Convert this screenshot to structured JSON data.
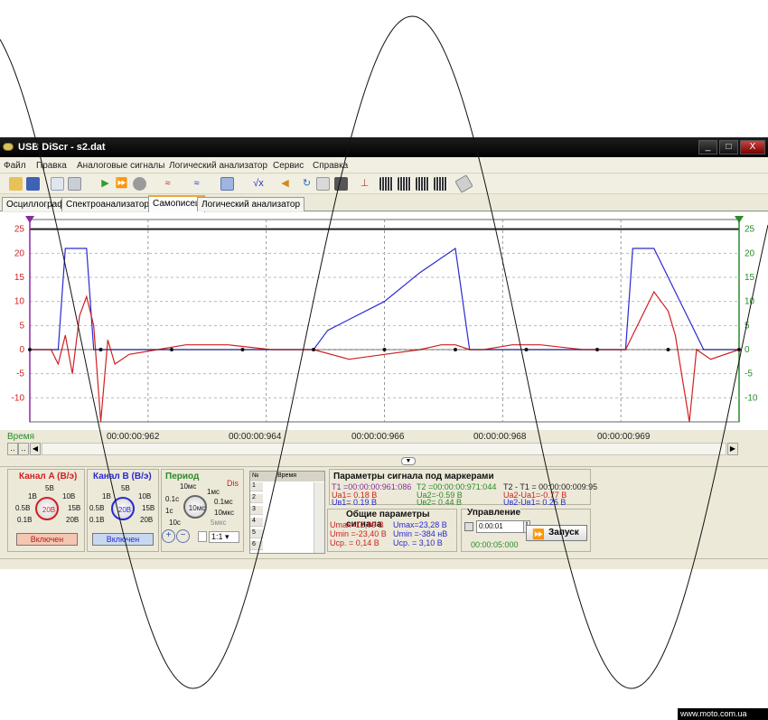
{
  "window": {
    "title": "USB DiScr - s2.dat",
    "min_label": "_",
    "max_label": "□",
    "close_label": "X"
  },
  "menu": [
    "Файл",
    "Правка",
    "Аналоговые сигналы",
    "Логический анализатор",
    "Сервис",
    "Справка"
  ],
  "toolbar": {
    "icons": [
      "open-folder-icon",
      "save-icon",
      "print-preview-icon",
      "print-icon",
      "play-icon",
      "play-step-icon",
      "stop-icon",
      "signal-a-icon",
      "signal-b-icon",
      "table-icon",
      "sqrt-icon",
      "speaker-icon",
      "refresh-icon",
      "copy-icon",
      "save-disk-icon",
      "export-icon",
      "channel-1-icon",
      "channel-2-icon",
      "channel-3-icon",
      "channel-4-icon",
      "eraser-icon"
    ]
  },
  "tabs": [
    {
      "label": "Осциллограф",
      "active": false
    },
    {
      "label": "Спектроанализатор",
      "active": false
    },
    {
      "label": "Самописец",
      "active": true
    },
    {
      "label": "Логический анализатор",
      "active": false
    }
  ],
  "chart_data": {
    "type": "line",
    "xlabel": "Время",
    "x_tick_labels": [
      "00:00:00:962",
      "00:00:00:964",
      "00:00:00:966",
      "00:00:00:968",
      "00:00:00:969"
    ],
    "left_axis_ticks": [
      "25",
      "20",
      "15",
      "10",
      "5",
      "0",
      "-5",
      "-10"
    ],
    "right_axis_ticks": [
      "25",
      "20",
      "15",
      "10",
      "5",
      "0",
      "-5",
      "-10"
    ],
    "ylim": [
      -15,
      27
    ],
    "grid": true,
    "series": [
      {
        "color": "#2a2ad0",
        "x": [
          0,
          4,
          5,
          7,
          8,
          9,
          12,
          20,
          30,
          40,
          41,
          42,
          50,
          55,
          60,
          62,
          70,
          75,
          80,
          84,
          85,
          88,
          95,
          100
        ],
        "values": [
          0,
          0,
          21,
          21,
          21,
          0,
          0,
          0,
          0,
          0,
          2,
          4,
          10,
          16,
          21,
          0,
          0,
          0,
          0,
          0,
          21,
          21,
          0,
          0
        ]
      },
      {
        "color": "#d02020",
        "x": [
          0,
          3,
          4,
          5,
          6,
          7,
          8,
          9,
          10,
          11,
          12,
          14,
          18,
          22,
          28,
          34,
          40,
          45,
          50,
          55,
          58,
          60,
          62,
          64,
          68,
          72,
          78,
          84,
          88,
          90,
          91,
          92,
          93,
          94,
          96,
          100
        ],
        "values": [
          0,
          0,
          -3,
          3,
          -5,
          7,
          11,
          5,
          -15,
          2,
          -3,
          -1,
          0,
          1,
          1,
          0,
          0,
          -2,
          -1,
          0,
          1,
          1,
          0,
          0,
          1,
          1,
          0,
          0,
          12,
          8,
          3,
          -6,
          -15,
          0,
          -2,
          0
        ]
      },
      {
        "color": "#000000",
        "x": [
          0,
          8,
          10,
          12,
          14,
          16,
          18,
          20,
          22,
          24,
          26,
          28,
          30,
          32,
          34,
          36,
          38,
          40,
          42,
          44,
          46,
          48,
          50,
          52,
          54,
          56,
          58,
          60,
          62,
          64,
          66,
          68,
          70,
          72,
          74,
          76,
          78,
          80,
          82,
          84,
          86,
          88,
          90,
          92,
          94,
          96,
          98,
          100
        ],
        "values": [
          0,
          0,
          0,
          0,
          0,
          0,
          0,
          0,
          0,
          0,
          0,
          0,
          0,
          0,
          0,
          0,
          0,
          0,
          0,
          0,
          0,
          0,
          0,
          0,
          0,
          0,
          0,
          0,
          0,
          0,
          0,
          0,
          0,
          0,
          0,
          0,
          0,
          0,
          0,
          0,
          0,
          0,
          0,
          0,
          0,
          0,
          0,
          0
        ]
      }
    ]
  },
  "time_row": {
    "label": "Время"
  },
  "channel_a": {
    "title": "Канал A (В/э)",
    "value": "20В",
    "labels": [
      "5В",
      "1В",
      "10В",
      "0.5В",
      "15В",
      "0.1В",
      "20В"
    ],
    "button": "Включен"
  },
  "channel_b": {
    "title": "Канал B (В/э)",
    "value": "20В",
    "labels": [
      "5В",
      "1В",
      "10В",
      "0.5В",
      "15В",
      "0.1В",
      "20В"
    ],
    "button": "Включен"
  },
  "period": {
    "title": "Период",
    "dis": "Dis",
    "value": "10мс",
    "labels": [
      "10мс",
      "1мс",
      "0.1с",
      "0.1мс",
      "1с",
      "10мкс",
      "10с",
      "5мкс"
    ],
    "ratio": "1:1"
  },
  "marker_table": {
    "header_num": "№",
    "header_time": "Время",
    "rows": [
      "1",
      "2",
      "3",
      "4",
      "5",
      "6"
    ]
  },
  "marker_params": {
    "title": "Параметры сигнала под маркерами",
    "t1": "T1 =00:00:00:961:086",
    "t2": "T2 =00:00:00:971:044",
    "dt": "T2 - T1 = 00:00:00:009:95",
    "ua1": "Uа1= 0.18 В",
    "ub1": "Uв1= 0.19 В",
    "ua2": "Uа2=-0.59 В",
    "ub2": "Uв2= 0.44 В",
    "dua": "Uа2-Uа1=-0.77 В",
    "dub": "Uв2-Uв1= 0.25 В"
  },
  "general_params": {
    "title": "Общие параметры сигнала",
    "a_max": "Umax=12,09 В",
    "a_min": "Umin =-23,40 В",
    "a_avg": "Uср. = 0,14 В",
    "b_max": "Umax=23,28 В",
    "b_min": "Umin =-384 нВ",
    "b_avg": "Uср. = 3,10 В"
  },
  "control": {
    "title": "Управление",
    "time_input": "0:00:01",
    "elapsed": "00:00:05:000",
    "run_label": "Запуск"
  },
  "footer": {
    "text": "www.moto.com.ua"
  },
  "colors": {
    "channel_a": "#d02020",
    "channel_b": "#2a2ad0",
    "axis_left": "#d02020",
    "axis_right": "#2a8a2a",
    "marker_green": "#2a8a2a",
    "marker_purple": "#8a2aa0"
  }
}
